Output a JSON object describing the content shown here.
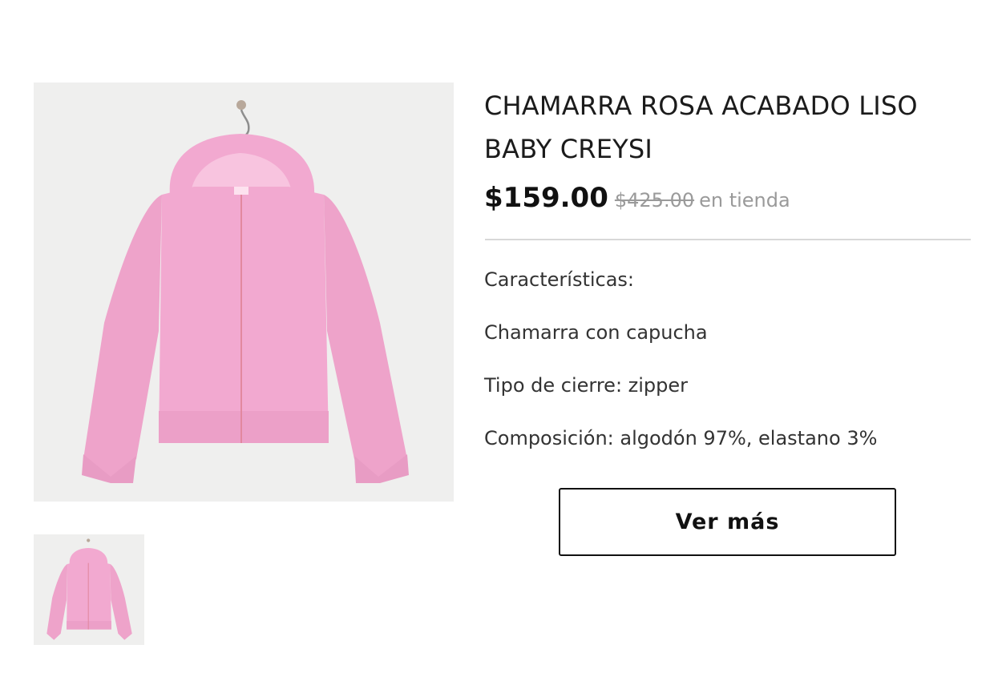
{
  "product": {
    "title": "CHAMARRA ROSA ACABADO LISO BABY CREYSI",
    "price": "$159.00",
    "old_price": "$425.00",
    "store_label": "en tienda",
    "image_alt": "pink zip hoodie on hanger",
    "colors": {
      "garment": "#f2a9d0",
      "background": "#efefee"
    }
  },
  "features": [
    "Características:",
    "Chamarra con capucha",
    "Tipo de cierre: zipper",
    "Composición: algodón 97%, elastano 3%"
  ],
  "actions": {
    "more_label": "Ver más"
  }
}
